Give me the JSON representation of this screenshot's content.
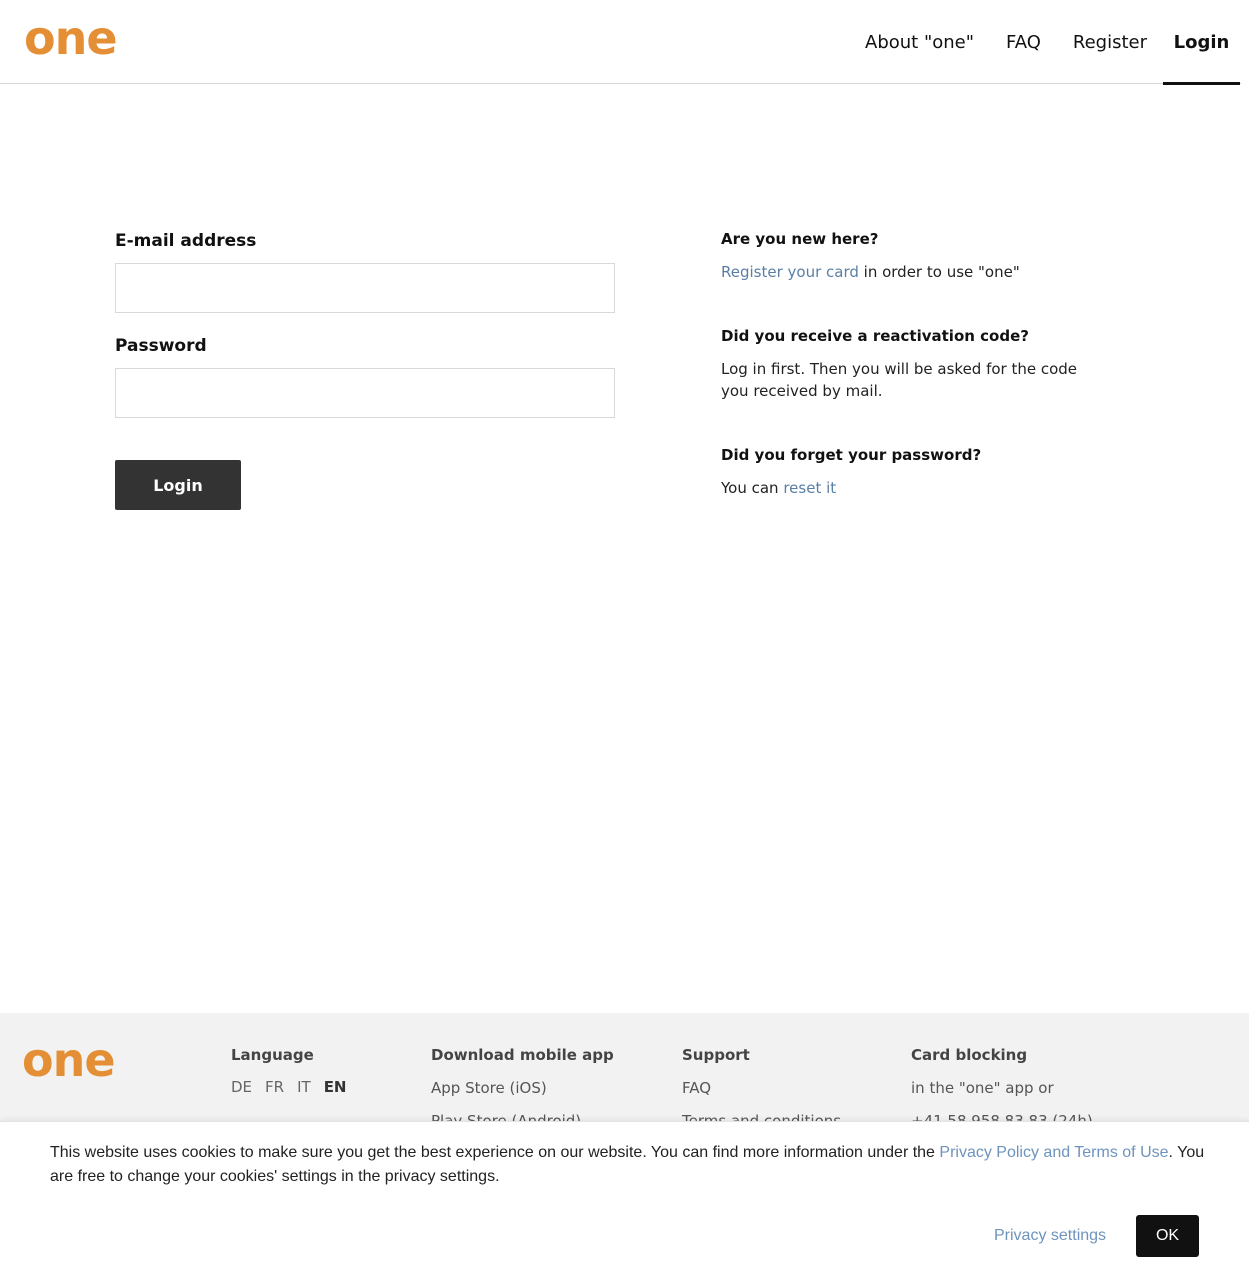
{
  "brand": {
    "logo_text": "one",
    "color": "#e48f35"
  },
  "nav": {
    "about": "About \"one\"",
    "faq": "FAQ",
    "register": "Register",
    "login": "Login"
  },
  "form": {
    "email_label": "E-mail address",
    "email_value": "",
    "password_label": "Password",
    "password_value": "",
    "login_button": "Login"
  },
  "info": {
    "new_title": "Are you new here?",
    "new_link": "Register your card",
    "new_text": " in order to use \"one\"",
    "reactivation_title": "Did you receive a reactivation code?",
    "reactivation_text": "Log in first. Then you will be asked for the code you received by mail.",
    "forgot_title": "Did you forget your password?",
    "forgot_text": "You can ",
    "forgot_link": "reset it"
  },
  "footer": {
    "logo_text": "one",
    "language": {
      "title": "Language",
      "options": [
        "DE",
        "FR",
        "IT",
        "EN"
      ],
      "selected": "EN"
    },
    "app": {
      "title": "Download mobile app",
      "items": [
        "App Store (iOS)",
        "Play Store (Android)"
      ]
    },
    "support": {
      "title": "Support",
      "items": [
        "FAQ",
        "Terms and conditions"
      ]
    },
    "blocking": {
      "title": "Card blocking",
      "items": [
        "in the \"one\" app or",
        "+41 58 958 83 83 (24h)"
      ]
    }
  },
  "cookie": {
    "text_before": "This website uses cookies to make sure you get the best experience on our website. You can find more information under the ",
    "link": "Privacy Policy and Terms of Use",
    "text_after": ". You are free to change your cookies' settings in the privacy settings.",
    "settings": "Privacy settings",
    "ok": "OK"
  }
}
